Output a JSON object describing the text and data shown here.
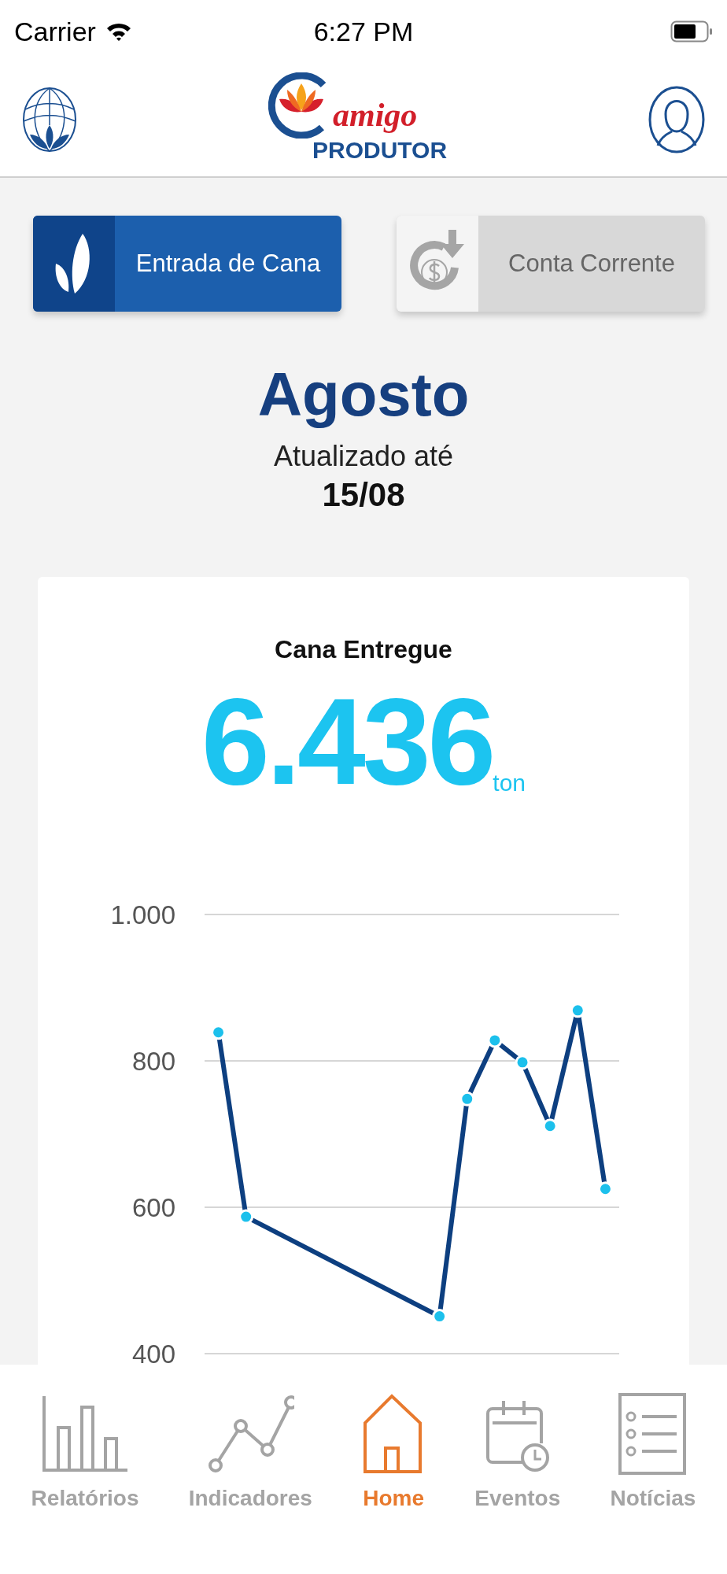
{
  "status_bar": {
    "carrier": "Carrier",
    "time": "6:27 PM"
  },
  "header": {
    "logo_top": "amigo",
    "logo_bottom": "PRODUTOR"
  },
  "toggle_buttons": [
    {
      "label": "Entrada de Cana",
      "selected": true,
      "kind": "leaf"
    },
    {
      "label": "Conta Corrente",
      "selected": false,
      "kind": "money"
    }
  ],
  "period": {
    "month": "Agosto",
    "updated_label": "Atualizado até",
    "date": "15/08"
  },
  "summary": {
    "title": "Cana Entregue",
    "value": "6.436",
    "unit": "ton"
  },
  "chart_data": {
    "type": "line",
    "categories": [
      null,
      null,
      null,
      null,
      null,
      null,
      null,
      null,
      null,
      null,
      null,
      null,
      null,
      null,
      null
    ],
    "ylim": [
      400,
      1000
    ],
    "yticks": [
      {
        "value": 400,
        "label": "400"
      },
      {
        "value": 600,
        "label": "600"
      },
      {
        "value": 800,
        "label": "800"
      },
      {
        "value": 1000,
        "label": "1.000"
      }
    ],
    "series": [
      {
        "color": "#0d3f80",
        "marker": "circle",
        "values": [
          839,
          587,
          null,
          null,
          null,
          null,
          null,
          null,
          451,
          748,
          828,
          798,
          711,
          869,
          625
        ]
      }
    ]
  },
  "tab_bar": [
    {
      "label": "Relatórios",
      "selected": false,
      "kind": "bars"
    },
    {
      "label": "Indicadores",
      "selected": false,
      "kind": "line"
    },
    {
      "label": "Home",
      "selected": true,
      "kind": "home"
    },
    {
      "label": "Eventos",
      "selected": false,
      "kind": "calendar"
    },
    {
      "label": "Notícias",
      "selected": false,
      "kind": "list"
    }
  ]
}
